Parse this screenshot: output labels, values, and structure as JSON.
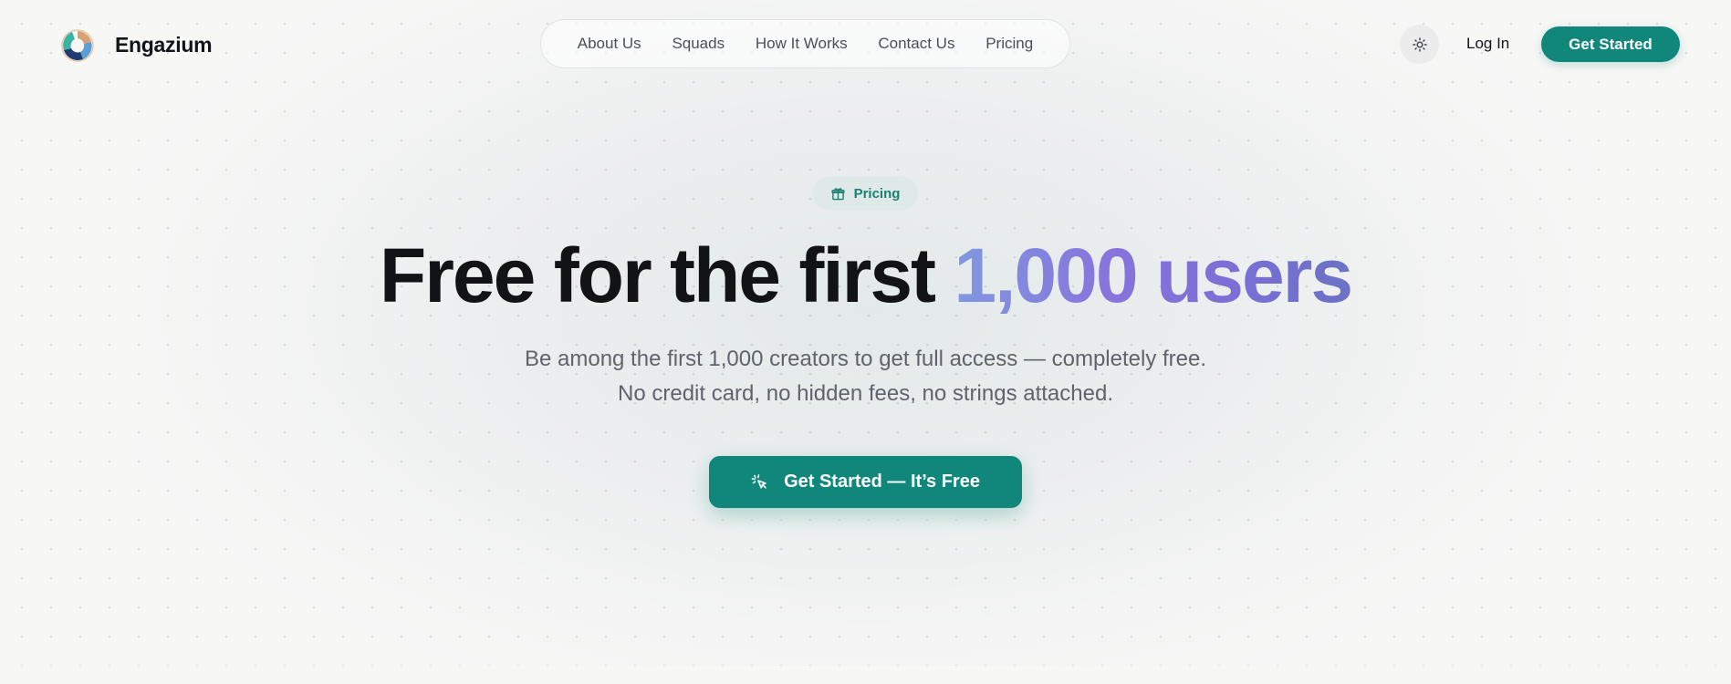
{
  "brand": {
    "name": "Engazium",
    "logo_icon": "swirl-logo-icon"
  },
  "nav": {
    "items": [
      {
        "label": "About Us"
      },
      {
        "label": "Squads"
      },
      {
        "label": "How It Works"
      },
      {
        "label": "Contact Us"
      },
      {
        "label": "Pricing"
      }
    ]
  },
  "header": {
    "theme_toggle_icon": "sun-icon",
    "login_label": "Log In",
    "cta_label": "Get Started"
  },
  "hero": {
    "badge": {
      "icon": "gift-icon",
      "label": "Pricing"
    },
    "title_main": "Free for the first",
    "title_accent": "1,000 users",
    "subtitle_line1": "Be among the first 1,000 creators to get full access — completely free.",
    "subtitle_line2": "No credit card, no hidden fees, no strings attached.",
    "cta": {
      "icon": "cursor-click-icon",
      "label": "Get Started — It’s Free"
    }
  },
  "colors": {
    "accent": "#11877c",
    "background": "#f7f7f6",
    "title": "#121317",
    "gradient_start": "#8098e0",
    "gradient_end": "#6b72c4"
  }
}
